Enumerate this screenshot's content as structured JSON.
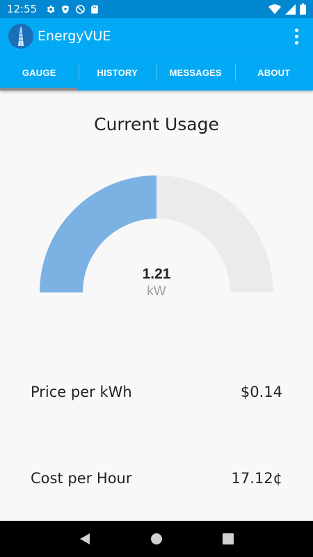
{
  "status_bar": {
    "time": "12:55",
    "icons_left": [
      "gear-icon",
      "shield-icon",
      "sync-disabled-icon",
      "sd-card-icon"
    ],
    "icons_right": [
      "wifi-icon",
      "signal-icon",
      "battery-icon"
    ]
  },
  "app_bar": {
    "title": "EnergyVUE",
    "logo": "building-logo-icon",
    "menu_icon": "overflow-menu-icon"
  },
  "tabs": [
    {
      "label": "GAUGE",
      "selected": true
    },
    {
      "label": "HISTORY",
      "selected": false
    },
    {
      "label": "MESSAGES",
      "selected": false
    },
    {
      "label": "ABOUT",
      "selected": false
    }
  ],
  "main": {
    "title": "Current Usage",
    "gauge": {
      "value": "1.21",
      "unit": "kW",
      "fill_fraction": 0.5,
      "fill_color": "#7bb1e3",
      "track_color": "#ecebec"
    },
    "rows": [
      {
        "label": "Price per kWh",
        "value": "$0.14"
      },
      {
        "label": "Cost per Hour",
        "value": "17.12¢"
      }
    ]
  },
  "nav_bar": {
    "buttons": [
      "back-icon",
      "home-icon",
      "recents-icon"
    ]
  },
  "colors": {
    "status_bar": "#0288d1",
    "app_bar": "#03a9f4",
    "tab_indicator": "#8a8a8a",
    "background": "#f8f8f8"
  }
}
